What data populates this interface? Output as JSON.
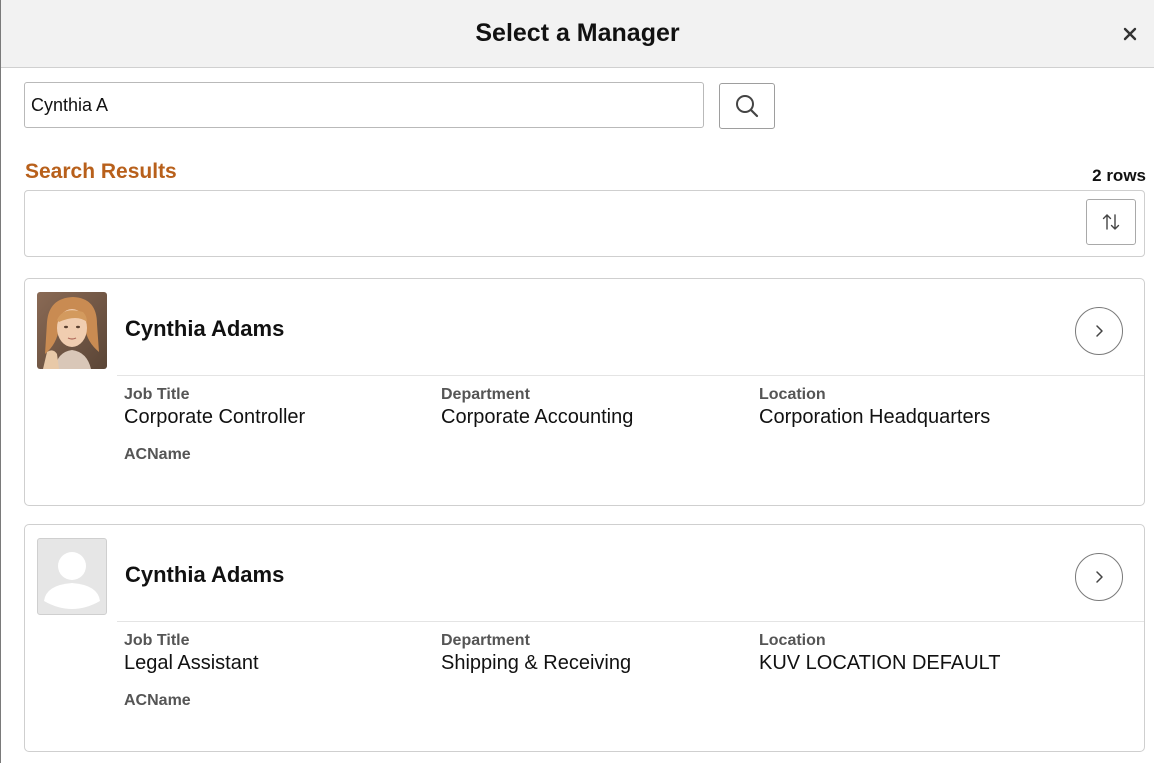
{
  "dialog": {
    "title": "Select a Manager",
    "close_label": "×"
  },
  "search": {
    "value": "Cynthia A"
  },
  "results": {
    "heading": "Search Results",
    "row_count": "2 rows",
    "items": [
      {
        "name": "Cynthia Adams",
        "photo": "person-photo",
        "job_title_label": "Job Title",
        "job_title": "Corporate Controller",
        "department_label": "Department",
        "department": "Corporate Accounting",
        "location_label": "Location",
        "location": "Corporation Headquarters",
        "extra_label": "ACName"
      },
      {
        "name": "Cynthia Adams",
        "photo": "placeholder-avatar",
        "job_title_label": "Job Title",
        "job_title": "Legal Assistant",
        "department_label": "Department",
        "department": "Shipping & Receiving",
        "location_label": "Location",
        "location": "KUV LOCATION DEFAULT",
        "extra_label": "ACName"
      }
    ]
  },
  "colors": {
    "accent": "#b8601b",
    "header_bg": "#f2f2f2",
    "border": "#cfcfcf"
  },
  "icons": [
    "close-icon",
    "search-icon",
    "sort-icon",
    "chevron-right-icon"
  ]
}
